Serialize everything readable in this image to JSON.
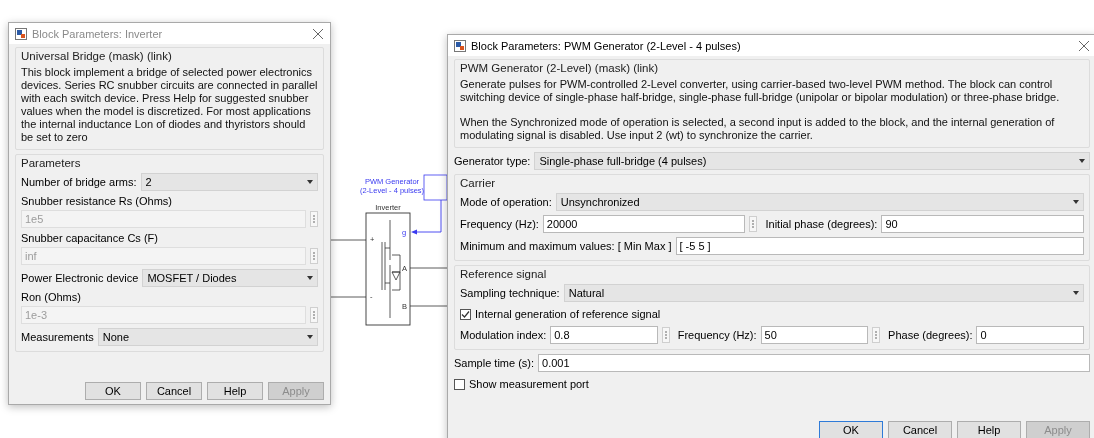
{
  "inverter_dialog": {
    "title": "Block Parameters: Inverter",
    "active": false,
    "mask_title": "Universal Bridge (mask) (link)",
    "description": "This block implement a bridge of selected power electronics devices.  Series RC snubber circuits are connected in parallel with each switch device.  Press Help for suggested snubber values when the model is discretized. For most applications the internal inductance Lon of diodes and thyristors should be set to zero",
    "parameters_title": "Parameters",
    "items": [
      {
        "kind": "dropdown",
        "label": "Number of bridge arms:",
        "value": "2"
      },
      {
        "kind": "labeled_field",
        "label": "Snubber resistance Rs (Ohms)",
        "value": "1e5",
        "disabled": true
      },
      {
        "kind": "labeled_field",
        "label": "Snubber capacitance Cs (F)",
        "value": "inf",
        "disabled": true
      },
      {
        "kind": "dropdown",
        "label": "Power Electronic device",
        "value": "MOSFET / Diodes"
      },
      {
        "kind": "labeled_field",
        "label": "Ron (Ohms)",
        "value": "1e-3",
        "disabled": true
      },
      {
        "kind": "dropdown",
        "label": "Measurements",
        "value": "None"
      }
    ],
    "buttons": [
      {
        "label": "OK",
        "disabled": false,
        "focused": false
      },
      {
        "label": "Cancel",
        "disabled": false,
        "focused": false
      },
      {
        "label": "Help",
        "disabled": false,
        "focused": false
      },
      {
        "label": "Apply",
        "disabled": true,
        "focused": false
      }
    ]
  },
  "diagram": {
    "pwm_label": [
      "PWM Generator",
      "(2-Level - 4 pulses)"
    ],
    "block_name": "Inverter",
    "control_port": "g",
    "input_ports": [
      "+",
      "-"
    ],
    "output_ports": [
      "A",
      "B"
    ]
  },
  "pwm_dialog": {
    "title": "Block Parameters: PWM Generator (2-Level - 4 pulses)",
    "active": true,
    "mask_title": "PWM Generator (2-Level) (mask) (link)",
    "description": [
      "Generate pulses for PWM-controlled 2-Level converter, using carrier-based two-level PWM method. The block can control switching device of single-phase half-bridge, single-phase full-bridge (unipolar or bipolar modulation) or three-phase bridge.",
      "When the Synchronized mode of operation is selected, a second input is added to the block, and the internal generation of modulating signal is disabled. Use input 2 (wt) to synchronize the carrier."
    ],
    "items": [
      {
        "kind": "dropdown",
        "label": "Generator type:",
        "value": "Single-phase full-bridge (4 pulses)"
      },
      {
        "kind": "group",
        "title": "Carrier",
        "items": [
          {
            "kind": "dropdown",
            "label": "Mode of operation:",
            "value": "Unsynchronized"
          },
          {
            "kind": "fields",
            "fields": [
              {
                "label": "Frequency (Hz):",
                "value": "20000"
              },
              {
                "label": "Initial phase (degrees):",
                "value": "90"
              }
            ]
          },
          {
            "kind": "fields",
            "fields": [
              {
                "label": "Minimum and maximum values: [ Min  Max ]",
                "value": "[ -5  5 ]"
              }
            ]
          }
        ]
      },
      {
        "kind": "group",
        "title": "Reference signal",
        "items": [
          {
            "kind": "dropdown",
            "label": "Sampling technique:",
            "value": "Natural"
          },
          {
            "kind": "checkbox",
            "label": "Internal generation of reference signal",
            "checked": true
          },
          {
            "kind": "fields",
            "fields": [
              {
                "label": "Modulation index:",
                "value": "0.8"
              },
              {
                "label": "Frequency (Hz):",
                "value": "50"
              },
              {
                "label": "Phase (degrees):",
                "value": "0"
              }
            ]
          }
        ]
      },
      {
        "kind": "fields",
        "fields": [
          {
            "label": "Sample time (s):",
            "value": "0.001"
          }
        ]
      },
      {
        "kind": "checkbox",
        "label": "Show measurement port",
        "checked": false
      }
    ],
    "buttons": [
      {
        "label": "OK",
        "disabled": false,
        "focused": true
      },
      {
        "label": "Cancel",
        "disabled": false,
        "focused": false
      },
      {
        "label": "Help",
        "disabled": false,
        "focused": false
      },
      {
        "label": "Apply",
        "disabled": true,
        "focused": false
      }
    ]
  }
}
